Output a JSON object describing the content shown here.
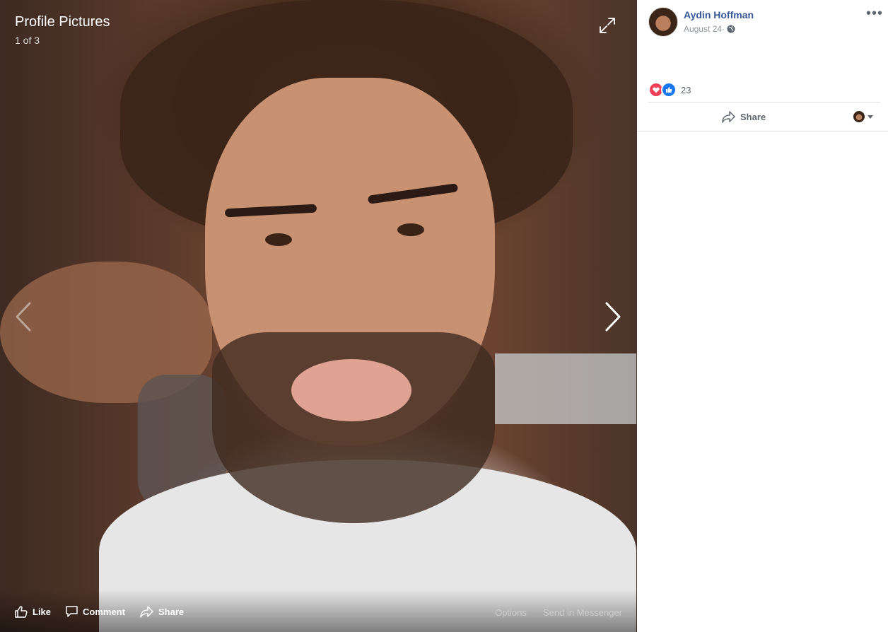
{
  "viewer": {
    "title": "Profile Pictures",
    "count": "1 of 3",
    "actions": {
      "like": "Like",
      "comment": "Comment",
      "share": "Share",
      "options": "Options",
      "messenger": "Send in Messenger"
    }
  },
  "post": {
    "author": "Aydin Hoffman",
    "date": "August 24",
    "separator": " ·",
    "reactions_count": "23",
    "share_label": "Share"
  },
  "icons": [
    "expand-icon",
    "chevron-left-icon",
    "chevron-right-icon",
    "thumbs-up-icon",
    "comment-icon",
    "share-icon",
    "globe-icon",
    "more-icon",
    "love-reaction-icon",
    "like-reaction-icon",
    "caret-down-icon"
  ],
  "colors": {
    "link": "#385898",
    "muted": "#90949c",
    "love": "#f33e58",
    "like": "#1877f2"
  }
}
